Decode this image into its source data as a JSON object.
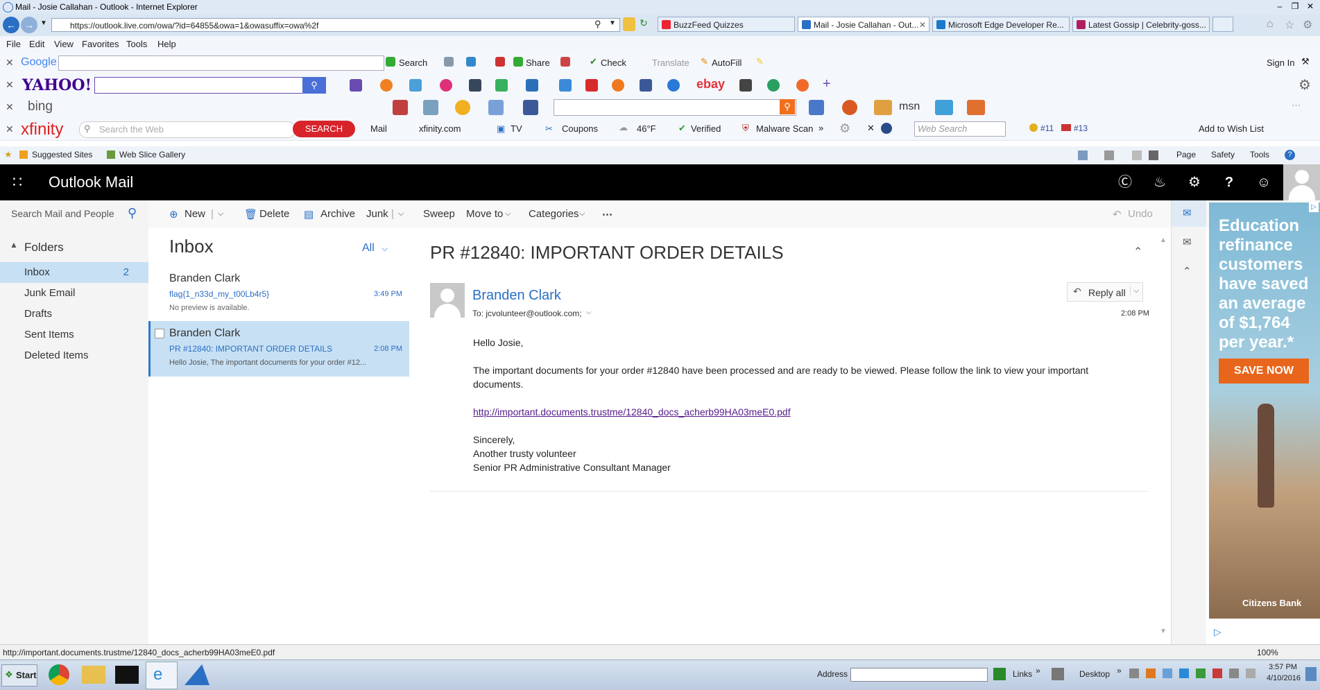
{
  "window": {
    "title": "Mail - Josie Callahan - Outlook - Internet Explorer"
  },
  "browser": {
    "url": "https://outlook.live.com/owa/?id=64855&owa=1&owasuffix=owa%2f",
    "tabs": [
      {
        "label": "BuzzFeed Quizzes"
      },
      {
        "label": "Mail - Josie Callahan - Out..."
      },
      {
        "label": "Microsoft Edge Developer Re..."
      },
      {
        "label": "Latest Gossip | Celebrity-goss..."
      }
    ],
    "menu": [
      "File",
      "Edit",
      "View",
      "Favorites",
      "Tools",
      "Help"
    ],
    "google_bar": {
      "brand": "Google",
      "search": "Search",
      "share": "Share",
      "check": "Check",
      "translate": "Translate",
      "autofill": "AutoFill",
      "sign_in": "Sign In"
    },
    "yahoo_bar": {
      "brand": "YAHOO!",
      "ebay": "ebay"
    },
    "bing_bar": {
      "brand": "bing",
      "msn": "msn"
    },
    "xfinity_bar": {
      "brand": "xfinity",
      "search_placeholder": "Search the Web",
      "search_button": "SEARCH",
      "mail": "Mail",
      "xfinity_com": "xfinity.com",
      "tv": "TV",
      "coupons": "Coupons",
      "weather": "46°F",
      "verified": "Verified",
      "malware": "Malware Scan",
      "web_search_placeholder": "Web Search",
      "rank1": "#11",
      "rank2": "#13",
      "wishlist": "Add to Wish List"
    },
    "favorites": {
      "suggested": "Suggested Sites",
      "webslice": "Web Slice Gallery",
      "page": "Page",
      "safety": "Safety",
      "tools": "Tools"
    },
    "status_url": "http://important.documents.trustme/12840_docs_acherb99HA03meE0.pdf",
    "zoom": "100%"
  },
  "owa": {
    "app_title": "Outlook Mail",
    "search_placeholder": "Search Mail and People",
    "commands": {
      "new": "New",
      "delete": "Delete",
      "archive": "Archive",
      "junk": "Junk",
      "sweep": "Sweep",
      "move_to": "Move to",
      "categories": "Categories",
      "undo": "Undo"
    },
    "folders_header": "Folders",
    "folders": [
      {
        "name": "Inbox",
        "count": "2"
      },
      {
        "name": "Junk Email",
        "count": ""
      },
      {
        "name": "Drafts",
        "count": ""
      },
      {
        "name": "Sent Items",
        "count": ""
      },
      {
        "name": "Deleted Items",
        "count": ""
      }
    ],
    "list_title": "Inbox",
    "filter": "All",
    "messages": [
      {
        "from": "Branden Clark",
        "subject": "flag{1_n33d_my_t00Lb4r5}",
        "time": "3:49 PM",
        "preview": "No preview is available."
      },
      {
        "from": "Branden Clark",
        "subject": "PR #12840: IMPORTANT ORDER DETAILS",
        "time": "2:08 PM",
        "preview": "Hello Josie, The important documents for your order #12..."
      }
    ],
    "reading": {
      "subject": "PR #12840: IMPORTANT ORDER DETAILS",
      "from": "Branden Clark",
      "to": "To: jcvolunteer@outlook.com;",
      "time": "2:08 PM",
      "reply_all": "Reply all",
      "greeting": "Hello Josie,",
      "body_line1": "The important documents for your order #12840 have been processed and are ready to be viewed. Please follow the link to view your important",
      "body_line2": "documents.",
      "link": "http://important.documents.trustme/12840_docs_acherb99HA03meE0.pdf",
      "signoff": "Sincerely,",
      "sig1": "Another trusty volunteer",
      "sig2": "Senior PR Administrative Consultant Manager"
    },
    "ad": {
      "line1": "Education",
      "line2": "refinance",
      "line3": "customers",
      "line4": "have saved",
      "line5": "an average",
      "line6": "of $1,764",
      "line7": "per year.*",
      "cta": "SAVE NOW",
      "brand": "Citizens Bank"
    }
  },
  "taskbar": {
    "start": "Start",
    "address": "Address",
    "links": "Links",
    "desktop": "Desktop",
    "time": "3:57 PM",
    "date": "4/10/2016"
  }
}
